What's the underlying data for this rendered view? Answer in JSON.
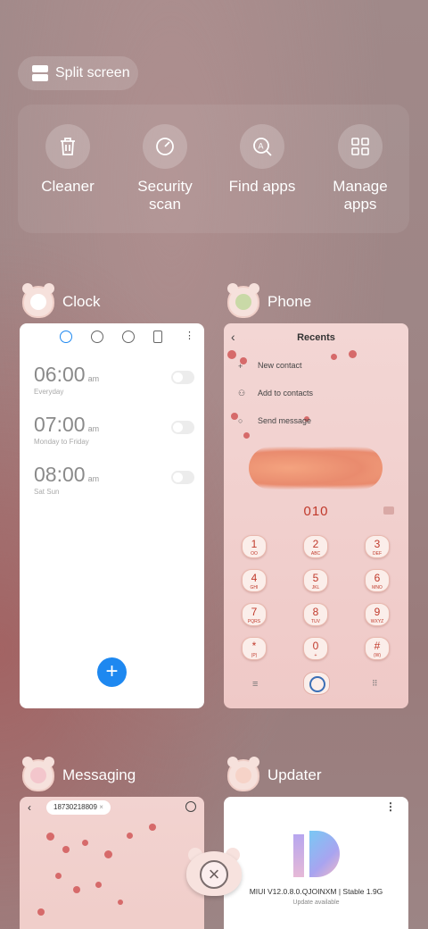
{
  "split_screen": {
    "label": "Split screen"
  },
  "tools": [
    {
      "label": "Cleaner",
      "icon": "trash-icon"
    },
    {
      "label": "Security\nscan",
      "icon": "shield-scan-icon"
    },
    {
      "label": "Find apps",
      "icon": "search-apps-icon"
    },
    {
      "label": "Manage\napps",
      "icon": "grid-icon"
    }
  ],
  "apps": {
    "clock": {
      "name": "Clock",
      "alarms": [
        {
          "time": "06:00",
          "ampm": "am",
          "days": "Everyday"
        },
        {
          "time": "07:00",
          "ampm": "am",
          "days": "Monday to Friday"
        },
        {
          "time": "08:00",
          "ampm": "am",
          "days": "Sat Sun"
        }
      ],
      "fab": "+"
    },
    "phone": {
      "name": "Phone",
      "title": "Recents",
      "actions": [
        "New contact",
        "Add to contacts",
        "Send message"
      ],
      "number": "010",
      "keys": [
        {
          "n": "1",
          "s": "OO"
        },
        {
          "n": "2",
          "s": "ABC"
        },
        {
          "n": "3",
          "s": "DEF"
        },
        {
          "n": "4",
          "s": "GHI"
        },
        {
          "n": "5",
          "s": "JKL"
        },
        {
          "n": "6",
          "s": "MNO"
        },
        {
          "n": "7",
          "s": "PQRS"
        },
        {
          "n": "8",
          "s": "TUV"
        },
        {
          "n": "9",
          "s": "WXYZ"
        },
        {
          "n": "*",
          "s": "(P)"
        },
        {
          "n": "0",
          "s": "+"
        },
        {
          "n": "#",
          "s": "(W)"
        }
      ]
    },
    "messaging": {
      "name": "Messaging",
      "contact_number": "18730218809"
    },
    "updater": {
      "name": "Updater",
      "version": "MIUI V12.0.8.0.QJOINXM | Stable 1.9G",
      "status": "Update available"
    }
  },
  "colors": {
    "accent_blue": "#1e88f0",
    "dial_red": "#c0392b"
  }
}
